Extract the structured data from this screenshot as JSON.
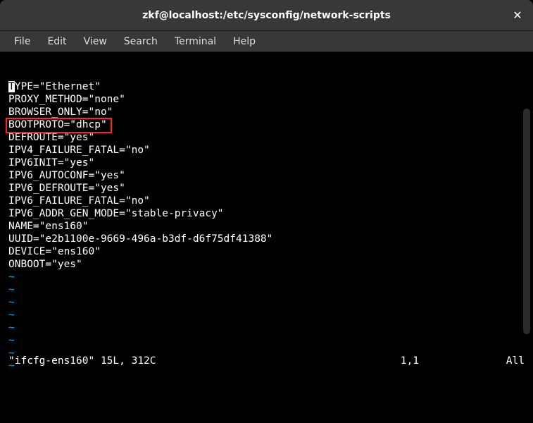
{
  "title": "zkf@localhost:/etc/sysconfig/network-scripts",
  "close_glyph": "✕",
  "menu": {
    "file": "File",
    "edit": "Edit",
    "view": "View",
    "search": "Search",
    "terminal": "Terminal",
    "help": "Help"
  },
  "content": {
    "lines": [
      "TYPE=\"Ethernet\"",
      "PROXY_METHOD=\"none\"",
      "BROWSER_ONLY=\"no\"",
      "BOOTPROTO=\"dhcp\"",
      "DEFROUTE=\"yes\"",
      "IPV4_FAILURE_FATAL=\"no\"",
      "IPV6INIT=\"yes\"",
      "IPV6_AUTOCONF=\"yes\"",
      "IPV6_DEFROUTE=\"yes\"",
      "IPV6_FAILURE_FATAL=\"no\"",
      "IPV6_ADDR_GEN_MODE=\"stable-privacy\"",
      "NAME=\"ens160\"",
      "UUID=\"e2b1100e-9669-496a-b3df-d6f75df41388\"",
      "DEVICE=\"ens160\"",
      "ONBOOT=\"yes\""
    ],
    "tilde": "~",
    "tilde_count": 8,
    "cursor_on_first_char": true,
    "highlightedLine": "BOOTPROTO=\"dhcp\""
  },
  "status": {
    "left": "\"ifcfg-ens160\" 15L, 312C",
    "position": "1,1",
    "right": "All"
  }
}
